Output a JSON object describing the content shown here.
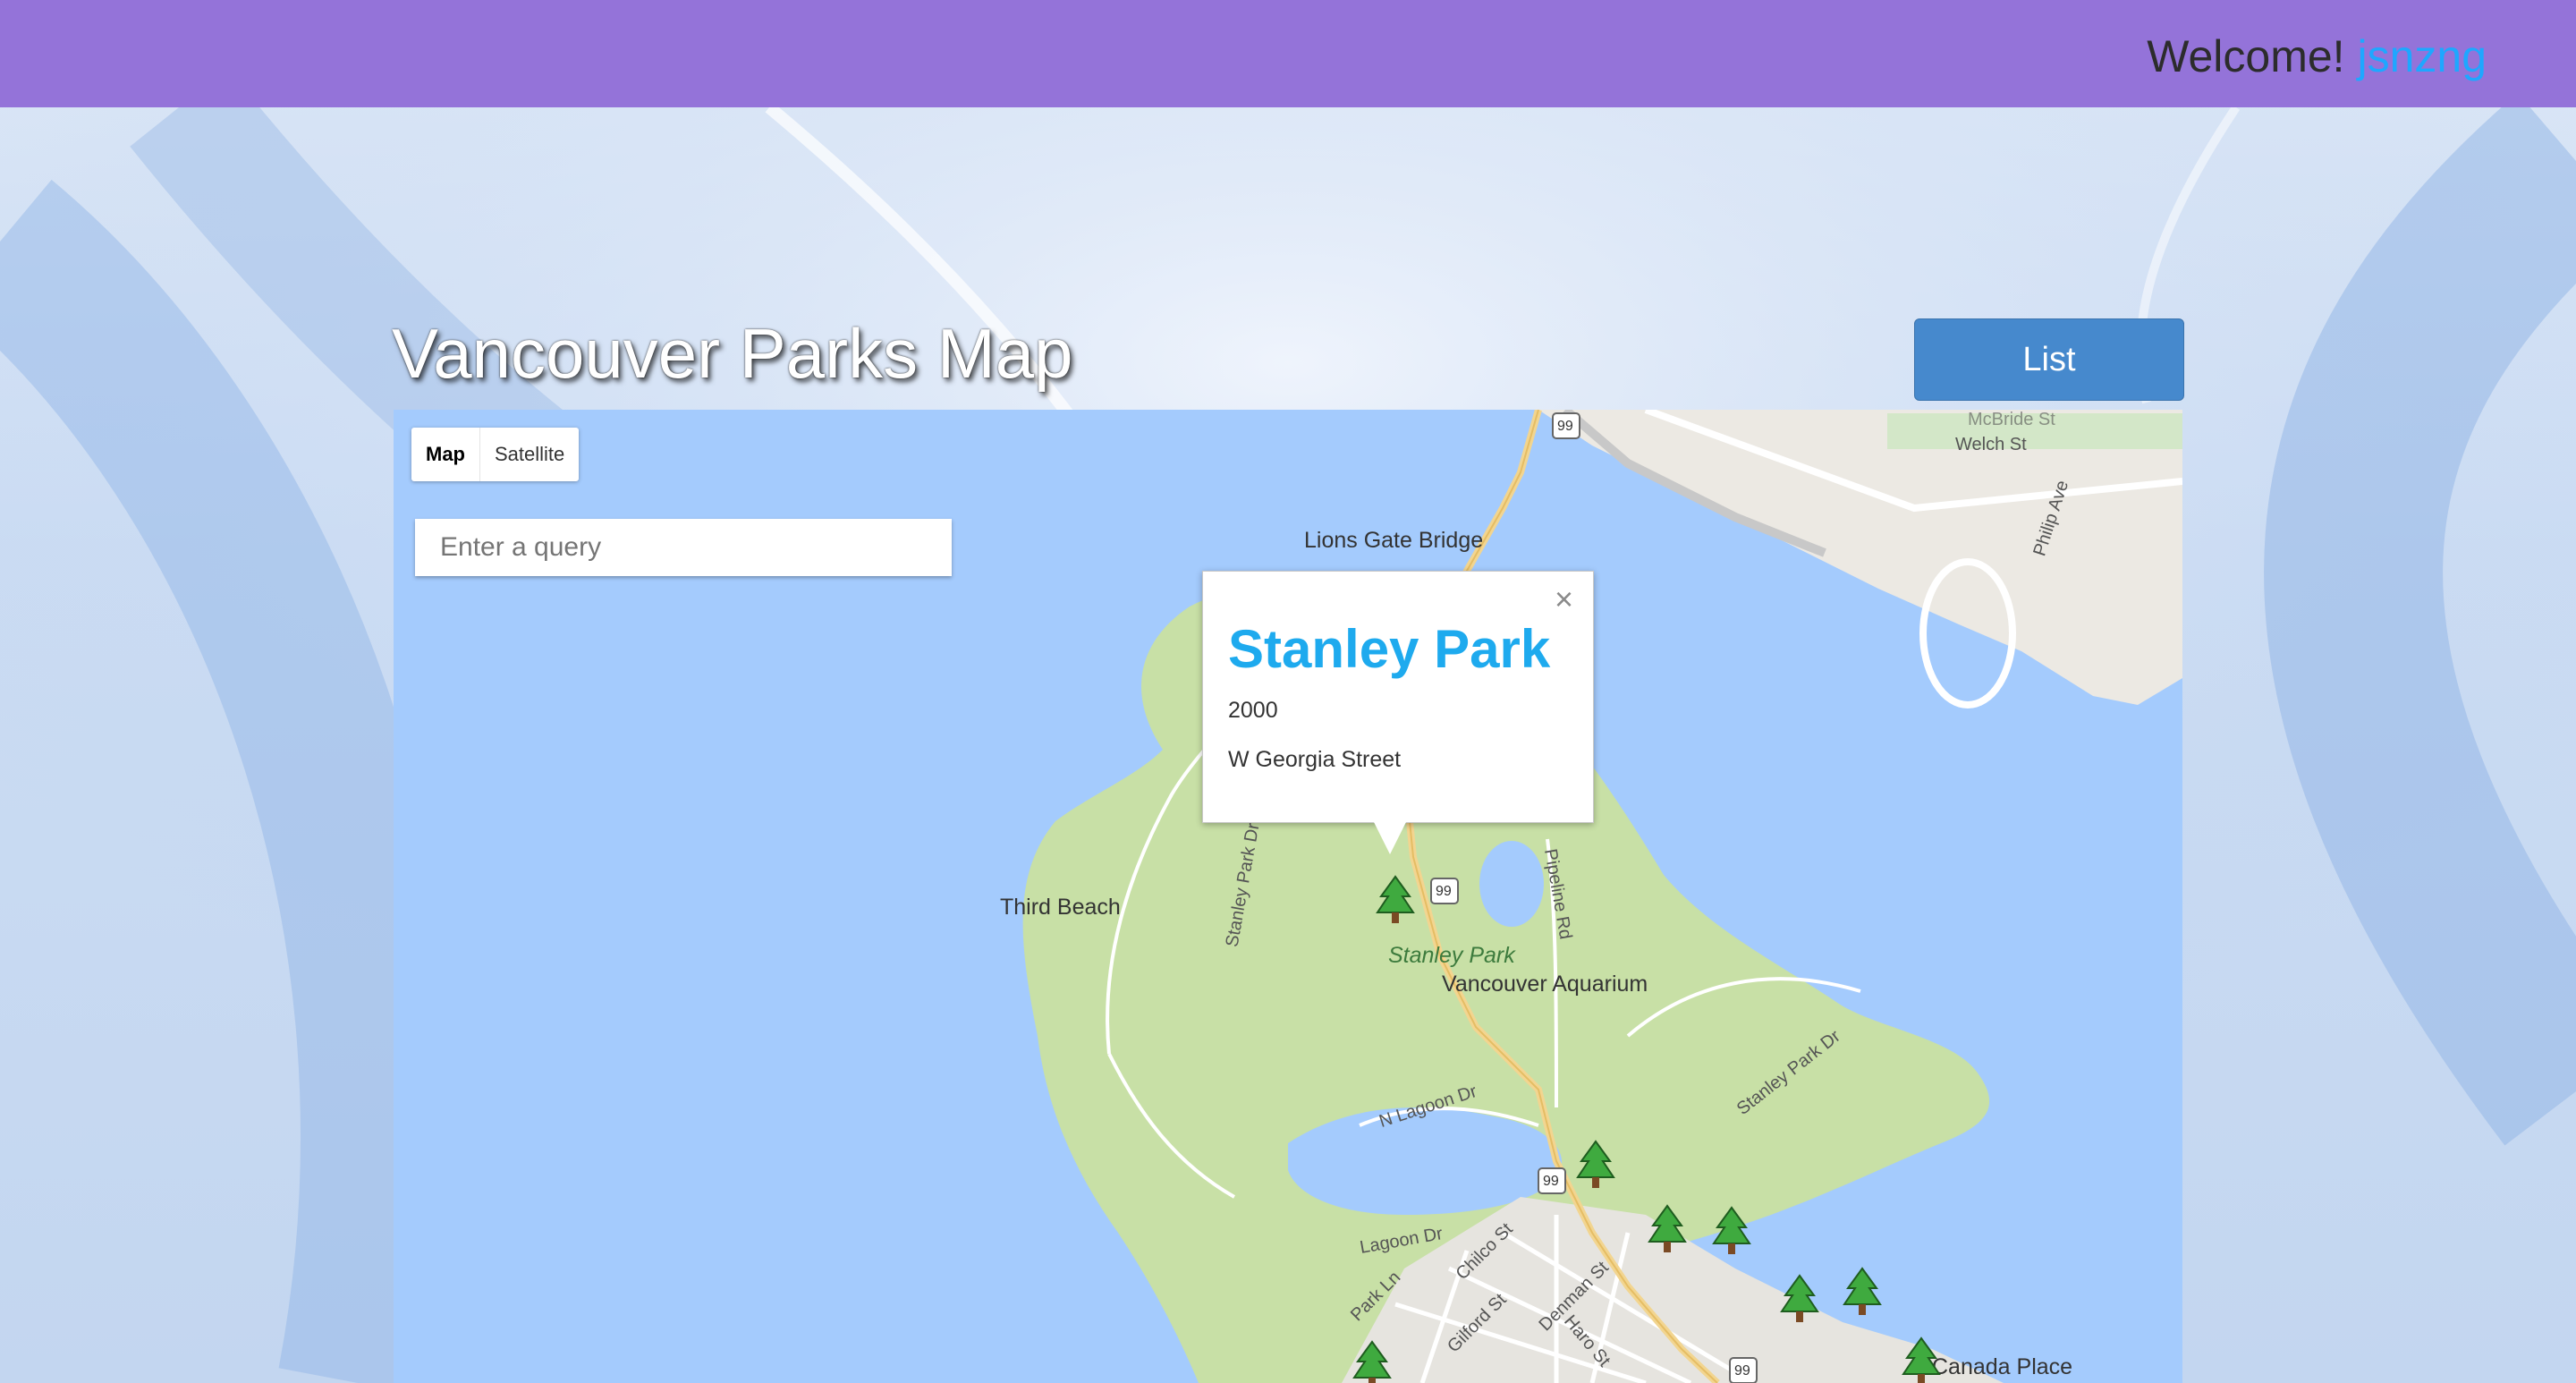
{
  "header": {
    "welcome_label": "Welcome!",
    "username": "jsnzng"
  },
  "page": {
    "title": "Vancouver Parks Map",
    "list_button": "List"
  },
  "map": {
    "map_types": [
      "Map",
      "Satellite"
    ],
    "selected_type": "Map",
    "search_placeholder": "Enter a query",
    "info_window": {
      "name": "Stanley Park",
      "line1": "2000",
      "line2": "W Georgia Street",
      "close_icon": "close-icon"
    },
    "labels": {
      "lions_gate": "Lions Gate Bridge",
      "third_beach": "Third Beach",
      "stanley_park": "Stanley Park",
      "aquarium": "Vancouver Aquarium",
      "canada_place": "Canada Place",
      "welch_st": "Welch St",
      "mcbride_st": "McBride St",
      "philip_ave": "Philip Ave",
      "stanley_park_dr_w": "Stanley Park Dr",
      "stanley_park_dr_e": "Stanley Park Dr",
      "pipeline_rd": "Pipeline Rd",
      "n_lagoon_dr": "N Lagoon Dr",
      "lagoon_dr": "Lagoon Dr",
      "park_ln": "Park Ln",
      "chilco_st": "Chilco St",
      "gilford_st": "Gilford St",
      "denman_st": "Denman St",
      "haro_st": "Haro St",
      "highway": "99"
    },
    "marker_icon": "tree-icon"
  }
}
